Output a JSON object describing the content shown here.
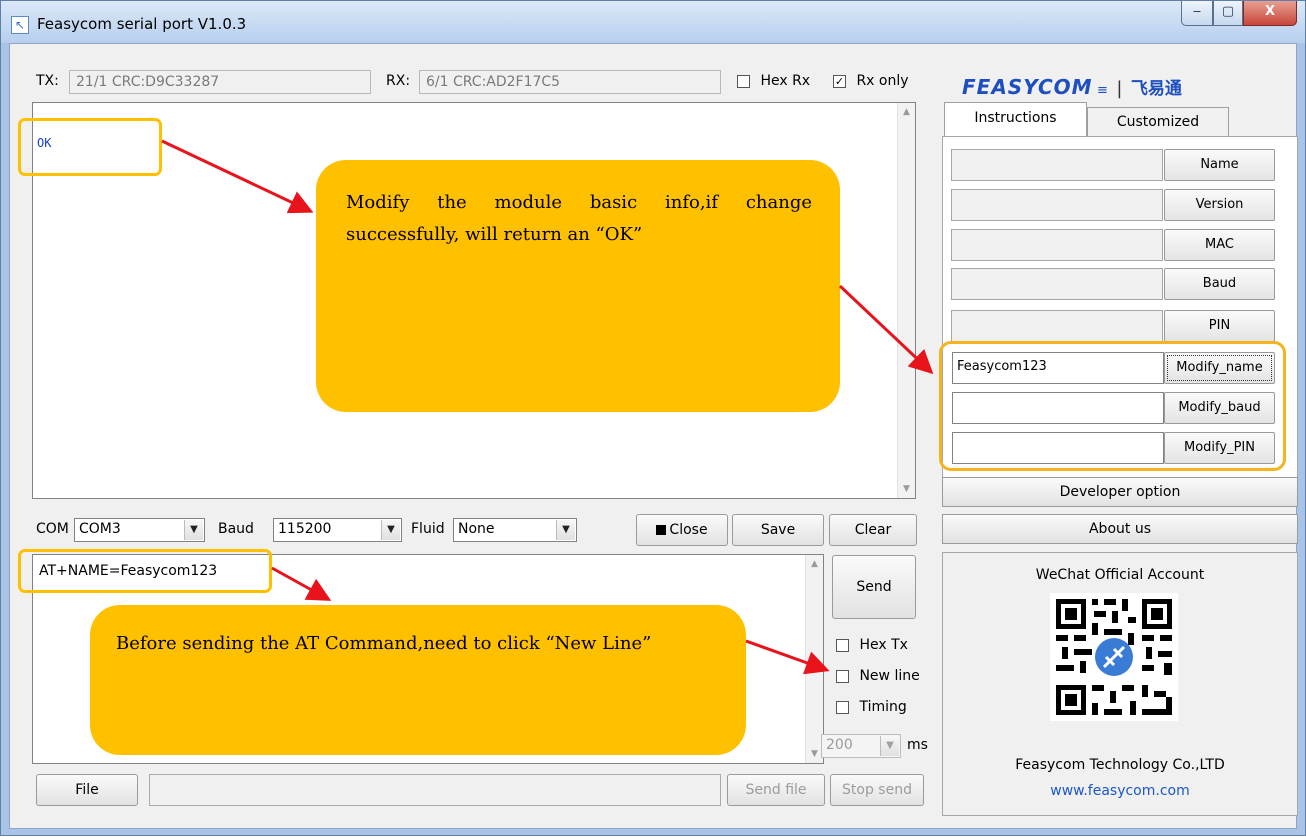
{
  "window": {
    "title": "Feasycom serial port V1.0.3",
    "min_label": "‒",
    "max_label": "▢",
    "close_label": "X"
  },
  "status": {
    "tx_label": "TX:",
    "tx_value": "21/1 CRC:D9C33287",
    "rx_label": "RX:",
    "rx_value": "6/1 CRC:AD2F17C5",
    "hex_rx_label": "Hex Rx",
    "hex_rx_checked": false,
    "rx_only_label": "Rx only",
    "rx_only_checked": true
  },
  "brand": {
    "logo_text": "FEASYCOM",
    "logo_cn": "飞易通"
  },
  "receive": {
    "text": "OK"
  },
  "settings": {
    "com_label": "COM",
    "com_value": "COM3",
    "baud_label": "Baud",
    "baud_value": "115200",
    "fluid_label": "Fluid",
    "fluid_value": "None",
    "close_button": "Close",
    "save_button": "Save",
    "clear_button": "Clear"
  },
  "send": {
    "text": "AT+NAME=Feasycom123",
    "send_button": "Send",
    "hex_tx_label": "Hex Tx",
    "new_line_label": "New line",
    "timing_label": "Timing",
    "interval_value": "200",
    "interval_unit": "ms",
    "file_button": "File",
    "send_file_button": "Send file",
    "stop_send_button": "Stop send"
  },
  "tabs": {
    "instructions": "Instructions",
    "customized": "Customized"
  },
  "instructions": {
    "name_button": "Name",
    "version_button": "Version",
    "mac_button": "MAC",
    "baud_button": "Baud",
    "pin_button": "PIN",
    "modify_name_value": "Feasycom123",
    "modify_name_button": "Modify_name",
    "modify_baud_button": "Modify_baud",
    "modify_pin_button": "Modify_PIN",
    "developer_option": "Developer option",
    "about_us": "About us"
  },
  "wechat": {
    "title": "WeChat Official Account",
    "company": "Feasycom Technology Co.,LTD",
    "website": "www.feasycom.com"
  },
  "annotations": {
    "callout_top": "Modify the module basic info,if change successfully, will return an “OK”",
    "callout_bottom": "Before sending the AT Command,need to click “New Line”"
  },
  "colors": {
    "callout_fill": "#ffc000",
    "arrow": "#e8131b",
    "logo_blue": "#1e4fbf",
    "link_blue": "#1b57c8"
  }
}
